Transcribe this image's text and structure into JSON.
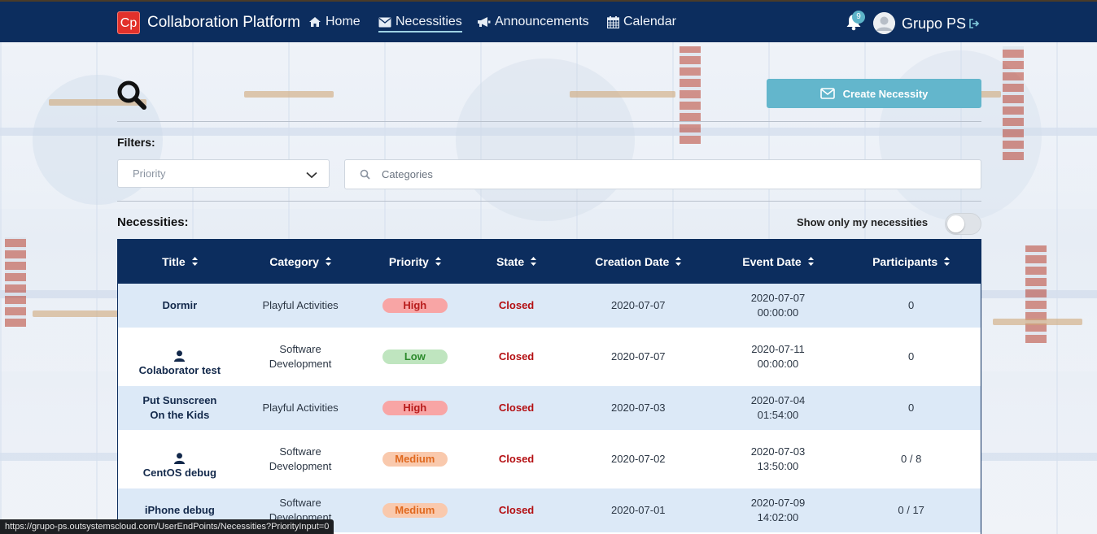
{
  "nav": {
    "brand_logo": "Cp",
    "brand_name": "Collaboration Platform",
    "home": "Home",
    "necessities": "Necessities",
    "announcements": "Announcements",
    "calendar": "Calendar",
    "notifications_count": "9",
    "user_name": "Grupo PS",
    "active_item": "necessities",
    "icons": [
      "home-icon",
      "envelope-icon",
      "megaphone-icon",
      "calendar-icon",
      "bell-icon",
      "avatar",
      "logout-icon"
    ]
  },
  "toolbar": {
    "create_label": "Create Necessity"
  },
  "filters": {
    "label": "Filters:",
    "priority_placeholder": "Priority",
    "categories_placeholder": "Categories"
  },
  "list": {
    "label": "Necessities:",
    "toggle_label": "Show only my necessities",
    "toggle_on": false
  },
  "table": {
    "headers": [
      "Title",
      "Category",
      "Priority",
      "State",
      "Creation Date",
      "Event Date",
      "Participants"
    ],
    "rows": [
      {
        "title": "Dormir",
        "has_person_icon": false,
        "category_line1": "Playful Activities",
        "category_line2": "",
        "priority": "High",
        "state": "Closed",
        "creation_date": "2020-07-07",
        "event_date": "2020-07-07",
        "event_time": "00:00:00",
        "participants": "0"
      },
      {
        "title": "Colaborator test",
        "has_person_icon": true,
        "category_line1": "Software",
        "category_line2": "Development",
        "priority": "Low",
        "state": "Closed",
        "creation_date": "2020-07-07",
        "event_date": "2020-07-11",
        "event_time": "00:00:00",
        "participants": "0"
      },
      {
        "title_line1": "Put Sunscreen",
        "title_line2": "On the Kids",
        "has_person_icon": false,
        "category_line1": "Playful Activities",
        "category_line2": "",
        "priority": "High",
        "state": "Closed",
        "creation_date": "2020-07-03",
        "event_date": "2020-07-04",
        "event_time": "01:54:00",
        "participants": "0"
      },
      {
        "title": "CentOS debug",
        "has_person_icon": true,
        "category_line1": "Software",
        "category_line2": "Development",
        "priority": "Medium",
        "state": "Closed",
        "creation_date": "2020-07-02",
        "event_date": "2020-07-03",
        "event_time": "13:50:00",
        "participants": "0 / 8"
      },
      {
        "title": "iPhone debug",
        "has_person_icon": false,
        "category_line1": "Software",
        "category_line2": "Development",
        "priority": "Medium",
        "state": "Closed",
        "creation_date": "2020-07-01",
        "event_date": "2020-07-09",
        "event_time": "14:02:00",
        "participants": "0 / 17"
      }
    ]
  },
  "colors": {
    "navbar": "#0c2d5e",
    "create_button": "#63b6cc",
    "high": "#f8a5a5",
    "low": "#bfe5bf",
    "medium": "#f9c9ad",
    "closed": "#b40f12"
  },
  "status_bar_url": "https://grupo-ps.outsystemscloud.com/UserEndPoints/Necessities?PriorityInput=0"
}
